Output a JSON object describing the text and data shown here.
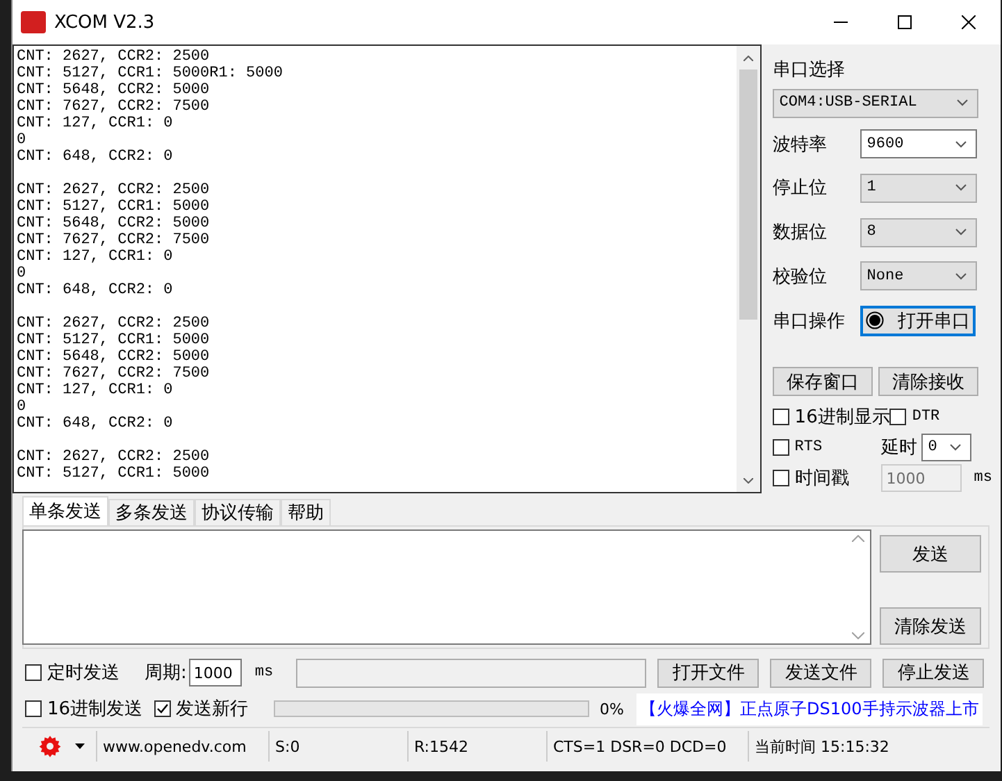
{
  "window": {
    "title": "XCOM V2.3"
  },
  "receive": {
    "blocks": [
      [
        "CNT: 2627, CCR2: 2500",
        "CNT: 5127, CCR1: 5000R1: 5000",
        "CNT: 5648, CCR2: 5000",
        "CNT: 7627, CCR2: 7500",
        "CNT: 127, CCR1: 0",
        "0",
        "CNT: 648, CCR2: 0"
      ],
      [
        "CNT: 2627, CCR2: 2500",
        "CNT: 5127, CCR1: 5000",
        "CNT: 5648, CCR2: 5000",
        "CNT: 7627, CCR2: 7500",
        "CNT: 127, CCR1: 0",
        "0",
        "CNT: 648, CCR2: 0"
      ],
      [
        "CNT: 2627, CCR2: 2500",
        "CNT: 5127, CCR1: 5000",
        "CNT: 5648, CCR2: 5000",
        "CNT: 7627, CCR2: 7500",
        "CNT: 127, CCR1: 0",
        "0",
        "CNT: 648, CCR2: 0"
      ],
      [
        "CNT: 2627, CCR2: 2500",
        "CNT: 5127, CCR1: 5000"
      ]
    ]
  },
  "serial": {
    "port_label": "串口选择",
    "port": "COM4:USB-SERIAL",
    "settings": [
      {
        "label": "波特率",
        "value": "9600",
        "editable": true
      },
      {
        "label": "停止位",
        "value": "1",
        "editable": false
      },
      {
        "label": "数据位",
        "value": "8",
        "editable": false
      },
      {
        "label": "校验位",
        "value": "None",
        "editable": false
      }
    ],
    "operation_label": "串口操作",
    "open_button": "打开串口"
  },
  "receive_buttons": [
    "保存窗口",
    "清除接收"
  ],
  "options": [
    {
      "label": "16进制显示",
      "checked": false
    },
    {
      "label": "DTR",
      "checked": false
    },
    {
      "label": "RTS",
      "checked": false
    }
  ],
  "delay": {
    "label": "延时",
    "value": "0"
  },
  "timestamp": {
    "label": "时间戳",
    "checked": false,
    "value": "1000",
    "disabled": true,
    "unit": "ms"
  },
  "tabs": [
    {
      "label": "单条发送",
      "selected": true
    },
    {
      "label": "多条发送",
      "selected": false
    },
    {
      "label": "协议传输",
      "selected": false
    },
    {
      "label": "帮助",
      "selected": false
    }
  ],
  "send_buttons": [
    "发送",
    "清除发送"
  ],
  "timed_send": {
    "label": "定时发送",
    "checked": false,
    "period_label": "周期:",
    "period": "1000",
    "unit": "ms"
  },
  "file_buttons": [
    "打开文件",
    "发送文件",
    "停止发送"
  ],
  "hex_send": {
    "label": "16进制发送",
    "checked": false
  },
  "send_newline": {
    "label": "发送新行",
    "checked": true
  },
  "progress": {
    "level": 0,
    "reading": "0%"
  },
  "ad": "【火爆全网】正点原子DS100手持示波器上市",
  "status_bar": {
    "website": "www.openedv.com",
    "sent": "S:0",
    "received": "R:1542",
    "signals": "CTS=1 DSR=0 DCD=0",
    "time": "当前时间 15:15:32"
  }
}
